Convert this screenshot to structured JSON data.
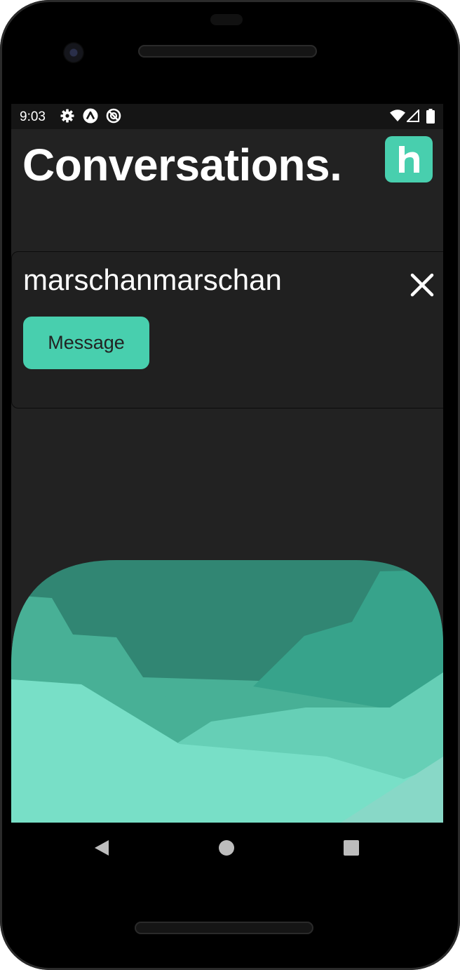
{
  "status_bar": {
    "time": "9:03",
    "left_icons": [
      "settings-icon",
      "app-a-icon",
      "no-sync-icon"
    ],
    "right_icons": [
      "wifi-icon",
      "signal-icon",
      "battery-icon"
    ]
  },
  "header": {
    "title": "Conversations.",
    "logo_letter": "h"
  },
  "conversation": {
    "username": "marschanmarschan",
    "message_label": "Message",
    "close_icon": "close-icon"
  },
  "nav_bar": {
    "buttons": [
      "back-icon",
      "home-icon",
      "recents-icon"
    ]
  },
  "colors": {
    "accent": "#48cfae",
    "background": "#222222",
    "text": "#ffffff"
  }
}
